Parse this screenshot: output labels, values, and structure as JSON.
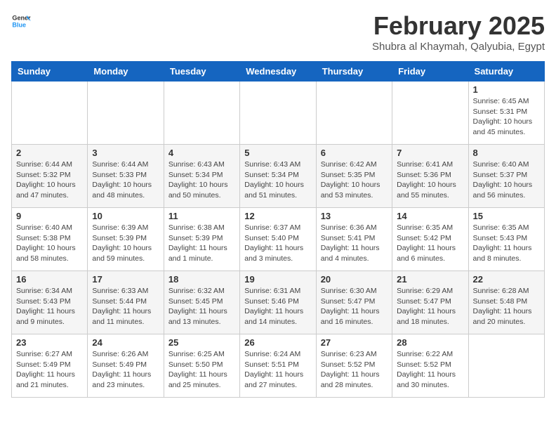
{
  "logo": {
    "general": "General",
    "blue": "Blue"
  },
  "header": {
    "title": "February 2025",
    "subtitle": "Shubra al Khaymah, Qalyubia, Egypt"
  },
  "weekdays": [
    "Sunday",
    "Monday",
    "Tuesday",
    "Wednesday",
    "Thursday",
    "Friday",
    "Saturday"
  ],
  "weeks": [
    [
      {
        "day": "",
        "info": ""
      },
      {
        "day": "",
        "info": ""
      },
      {
        "day": "",
        "info": ""
      },
      {
        "day": "",
        "info": ""
      },
      {
        "day": "",
        "info": ""
      },
      {
        "day": "",
        "info": ""
      },
      {
        "day": "1",
        "info": "Sunrise: 6:45 AM\nSunset: 5:31 PM\nDaylight: 10 hours and 45 minutes."
      }
    ],
    [
      {
        "day": "2",
        "info": "Sunrise: 6:44 AM\nSunset: 5:32 PM\nDaylight: 10 hours and 47 minutes."
      },
      {
        "day": "3",
        "info": "Sunrise: 6:44 AM\nSunset: 5:33 PM\nDaylight: 10 hours and 48 minutes."
      },
      {
        "day": "4",
        "info": "Sunrise: 6:43 AM\nSunset: 5:34 PM\nDaylight: 10 hours and 50 minutes."
      },
      {
        "day": "5",
        "info": "Sunrise: 6:43 AM\nSunset: 5:34 PM\nDaylight: 10 hours and 51 minutes."
      },
      {
        "day": "6",
        "info": "Sunrise: 6:42 AM\nSunset: 5:35 PM\nDaylight: 10 hours and 53 minutes."
      },
      {
        "day": "7",
        "info": "Sunrise: 6:41 AM\nSunset: 5:36 PM\nDaylight: 10 hours and 55 minutes."
      },
      {
        "day": "8",
        "info": "Sunrise: 6:40 AM\nSunset: 5:37 PM\nDaylight: 10 hours and 56 minutes."
      }
    ],
    [
      {
        "day": "9",
        "info": "Sunrise: 6:40 AM\nSunset: 5:38 PM\nDaylight: 10 hours and 58 minutes."
      },
      {
        "day": "10",
        "info": "Sunrise: 6:39 AM\nSunset: 5:39 PM\nDaylight: 10 hours and 59 minutes."
      },
      {
        "day": "11",
        "info": "Sunrise: 6:38 AM\nSunset: 5:39 PM\nDaylight: 11 hours and 1 minute."
      },
      {
        "day": "12",
        "info": "Sunrise: 6:37 AM\nSunset: 5:40 PM\nDaylight: 11 hours and 3 minutes."
      },
      {
        "day": "13",
        "info": "Sunrise: 6:36 AM\nSunset: 5:41 PM\nDaylight: 11 hours and 4 minutes."
      },
      {
        "day": "14",
        "info": "Sunrise: 6:35 AM\nSunset: 5:42 PM\nDaylight: 11 hours and 6 minutes."
      },
      {
        "day": "15",
        "info": "Sunrise: 6:35 AM\nSunset: 5:43 PM\nDaylight: 11 hours and 8 minutes."
      }
    ],
    [
      {
        "day": "16",
        "info": "Sunrise: 6:34 AM\nSunset: 5:43 PM\nDaylight: 11 hours and 9 minutes."
      },
      {
        "day": "17",
        "info": "Sunrise: 6:33 AM\nSunset: 5:44 PM\nDaylight: 11 hours and 11 minutes."
      },
      {
        "day": "18",
        "info": "Sunrise: 6:32 AM\nSunset: 5:45 PM\nDaylight: 11 hours and 13 minutes."
      },
      {
        "day": "19",
        "info": "Sunrise: 6:31 AM\nSunset: 5:46 PM\nDaylight: 11 hours and 14 minutes."
      },
      {
        "day": "20",
        "info": "Sunrise: 6:30 AM\nSunset: 5:47 PM\nDaylight: 11 hours and 16 minutes."
      },
      {
        "day": "21",
        "info": "Sunrise: 6:29 AM\nSunset: 5:47 PM\nDaylight: 11 hours and 18 minutes."
      },
      {
        "day": "22",
        "info": "Sunrise: 6:28 AM\nSunset: 5:48 PM\nDaylight: 11 hours and 20 minutes."
      }
    ],
    [
      {
        "day": "23",
        "info": "Sunrise: 6:27 AM\nSunset: 5:49 PM\nDaylight: 11 hours and 21 minutes."
      },
      {
        "day": "24",
        "info": "Sunrise: 6:26 AM\nSunset: 5:49 PM\nDaylight: 11 hours and 23 minutes."
      },
      {
        "day": "25",
        "info": "Sunrise: 6:25 AM\nSunset: 5:50 PM\nDaylight: 11 hours and 25 minutes."
      },
      {
        "day": "26",
        "info": "Sunrise: 6:24 AM\nSunset: 5:51 PM\nDaylight: 11 hours and 27 minutes."
      },
      {
        "day": "27",
        "info": "Sunrise: 6:23 AM\nSunset: 5:52 PM\nDaylight: 11 hours and 28 minutes."
      },
      {
        "day": "28",
        "info": "Sunrise: 6:22 AM\nSunset: 5:52 PM\nDaylight: 11 hours and 30 minutes."
      },
      {
        "day": "",
        "info": ""
      }
    ]
  ]
}
